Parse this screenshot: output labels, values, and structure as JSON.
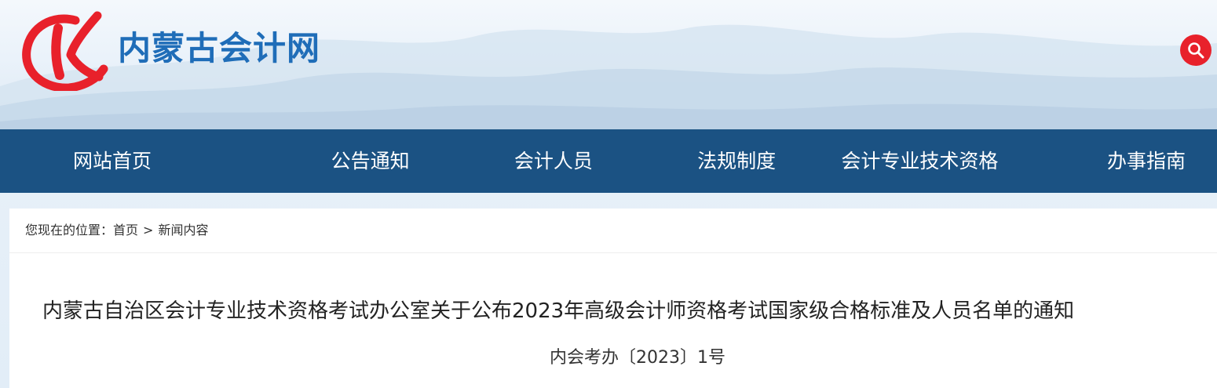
{
  "header": {
    "site_name": "内蒙古会计网",
    "logo_icon": "kuaiji-logo-icon",
    "search_icon": "search-icon",
    "brand_color": "#1f6db8",
    "accent_color": "#e8212b"
  },
  "nav": {
    "items": [
      {
        "label": "网站首页"
      },
      {
        "label": "公告通知"
      },
      {
        "label": "会计人员"
      },
      {
        "label": "法规制度"
      },
      {
        "label": "会计专业技术资格"
      },
      {
        "label": "办事指南"
      }
    ],
    "background": "#1b5283"
  },
  "breadcrumb": {
    "prefix": "您现在的位置：",
    "home": "首页",
    "separator": ">",
    "current": "新闻内容"
  },
  "article": {
    "title": "内蒙古自治区会计专业技术资格考试办公室关于公布2023年高级会计师资格考试国家级合格标准及人员名单的通知",
    "doc_number": "内会考办〔2023〕1号"
  }
}
